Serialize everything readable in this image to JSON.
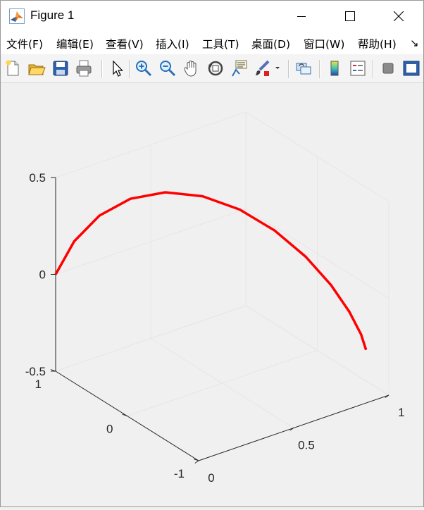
{
  "window": {
    "title": "Figure 1",
    "controls": [
      "minimize",
      "maximize",
      "close"
    ]
  },
  "menubar": {
    "items": [
      "文件(F)",
      "编辑(E)",
      "查看(V)",
      "插入(I)",
      "工具(T)",
      "桌面(D)",
      "窗口(W)",
      "帮助(H)"
    ],
    "overflow_glyph": "↘"
  },
  "toolbar": {
    "buttons": [
      {
        "name": "new-figure-icon"
      },
      {
        "name": "open-file-icon"
      },
      {
        "name": "save-figure-icon"
      },
      {
        "name": "print-figure-icon"
      },
      {
        "name": "edit-plot-arrow-icon"
      },
      {
        "name": "zoom-in-icon"
      },
      {
        "name": "zoom-out-icon"
      },
      {
        "name": "pan-hand-icon"
      },
      {
        "name": "rotate-3d-icon"
      },
      {
        "name": "data-cursor-icon"
      },
      {
        "name": "brush-icon"
      },
      {
        "name": "brush-dropdown-icon"
      },
      {
        "name": "link-plot-icon"
      },
      {
        "name": "insert-colorbar-icon"
      },
      {
        "name": "insert-legend-icon"
      },
      {
        "name": "hide-plot-tools-icon"
      },
      {
        "name": "show-plot-tools-icon"
      }
    ]
  },
  "axes": {
    "z_ticks": [
      "0.5",
      "0",
      "-0.5"
    ],
    "y_ticks": [
      "1",
      "0",
      "-1"
    ],
    "x_ticks": [
      "0",
      "0.5",
      "1"
    ],
    "line_color": "#ff0000",
    "grid": true,
    "box": false
  },
  "chart_data": {
    "type": "line",
    "projection": "3d",
    "title": "",
    "xlabel": "",
    "ylabel": "",
    "zlabel": "",
    "xlim": [
      0,
      1
    ],
    "ylim": [
      -1,
      1
    ],
    "zlim": [
      -0.5,
      0.5
    ],
    "series": [
      {
        "color": "#ff0000",
        "x": [
          0,
          0.079,
          0.159,
          0.238,
          0.317,
          0.397,
          0.476,
          0.555,
          0.635,
          0.714,
          0.793,
          0.873,
          0.952
        ],
        "y": [
          1,
          0.951,
          0.809,
          0.588,
          0.309,
          0,
          -0.309,
          -0.588,
          -0.809,
          -0.951,
          -1,
          -0.951,
          -0.809
        ],
        "z": [
          0,
          0.155,
          0.294,
          0.405,
          0.476,
          0.5,
          0.476,
          0.405,
          0.294,
          0.155,
          0,
          -0.155,
          -0.294
        ]
      }
    ]
  }
}
